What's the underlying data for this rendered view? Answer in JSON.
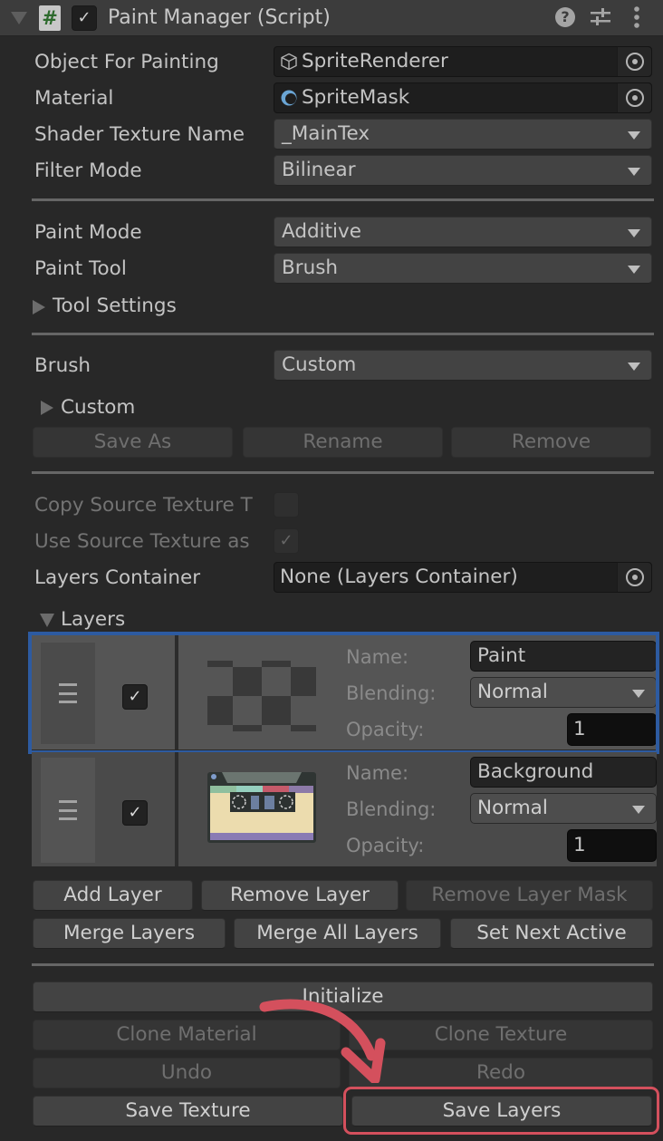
{
  "header": {
    "title": "Paint Manager (Script)",
    "enabled": true,
    "script_icon_glyph": "#",
    "icons": [
      "fold-triangle-icon",
      "script-icon",
      "help-icon",
      "preset-sliders-icon",
      "more-menu-icon"
    ]
  },
  "general": {
    "object_for_painting": {
      "label": "Object For Painting",
      "value": "SpriteRenderer",
      "icon": "component-cube-icon"
    },
    "material": {
      "label": "Material",
      "value": "SpriteMask",
      "icon": "material-sphere-icon"
    },
    "shader_texture_name": {
      "label": "Shader Texture Name",
      "value": "_MainTex"
    },
    "filter_mode": {
      "label": "Filter Mode",
      "value": "Bilinear"
    }
  },
  "paint": {
    "paint_mode": {
      "label": "Paint Mode",
      "value": "Additive"
    },
    "paint_tool": {
      "label": "Paint Tool",
      "value": "Brush"
    },
    "tool_settings": {
      "label": "Tool Settings",
      "expanded": false
    }
  },
  "brush": {
    "label": "Brush",
    "value": "Custom",
    "foldout": {
      "label": "Custom",
      "expanded": false
    },
    "buttons": {
      "save_as": "Save As",
      "rename": "Rename",
      "remove": "Remove"
    }
  },
  "source": {
    "copy_source_texture": {
      "label": "Copy Source Texture T",
      "checked": false
    },
    "use_source_texture": {
      "label": "Use Source Texture as",
      "checked": true
    },
    "layers_container": {
      "label": "Layers Container",
      "value": "None (Layers Container)"
    }
  },
  "layers": {
    "label": "Layers",
    "expanded": true,
    "field_labels": {
      "name": "Name:",
      "blending": "Blending:",
      "opacity": "Opacity:"
    },
    "items": [
      {
        "name": "Paint",
        "blending": "Normal",
        "opacity": "1",
        "enabled": true,
        "selected": true,
        "thumbnail": "transparent-checker"
      },
      {
        "name": "Background",
        "blending": "Normal",
        "opacity": "1",
        "enabled": true,
        "selected": false,
        "thumbnail": "cassette-tape-image"
      }
    ],
    "buttons": {
      "add_layer": "Add Layer",
      "remove_layer": "Remove Layer",
      "remove_layer_mask": "Remove Layer Mask",
      "merge_layers": "Merge Layers",
      "merge_all_layers": "Merge All Layers",
      "set_next_active": "Set Next Active"
    }
  },
  "actions": {
    "initialize": "Initialize",
    "clone_material": "Clone Material",
    "clone_texture": "Clone Texture",
    "undo": "Undo",
    "redo": "Redo",
    "save_texture": "Save Texture",
    "save_layers": "Save Layers"
  },
  "colors": {
    "selection_outline": "#2d5ba1",
    "annotation": "#d4505d",
    "panel_bg": "#282828"
  }
}
